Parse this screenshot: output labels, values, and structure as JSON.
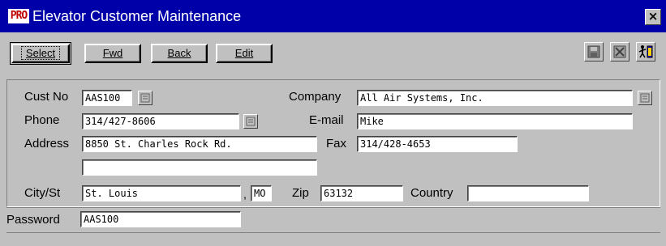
{
  "window": {
    "icon_text": "PRO",
    "title": "Elevator Customer Maintenance",
    "close_glyph": "×"
  },
  "toolbar": {
    "select_label": "Select",
    "fwd_label": "Fwd",
    "back_label": "Back",
    "edit_label": "Edit",
    "icons": [
      "save-icon",
      "cancel-icon",
      "exit-icon"
    ]
  },
  "form": {
    "cust_no": {
      "label": "Cust No",
      "value": "AAS100"
    },
    "company": {
      "label": "Company",
      "value": "All Air Systems, Inc."
    },
    "phone": {
      "label": "Phone",
      "value": "314/427-8606"
    },
    "email": {
      "label": "E-mail",
      "value": "Mike"
    },
    "address": {
      "label": "Address",
      "value": "8850 St. Charles Rock Rd.",
      "line2": ""
    },
    "fax": {
      "label": "Fax",
      "value": "314/428-4653"
    },
    "city_st": {
      "label": "City/St",
      "city": "St. Louis",
      "separator": ",",
      "state": "MO"
    },
    "zip": {
      "label": "Zip",
      "value": "63132"
    },
    "country": {
      "label": "Country",
      "value": ""
    },
    "password": {
      "label": "Password",
      "value": "AAS100"
    }
  }
}
